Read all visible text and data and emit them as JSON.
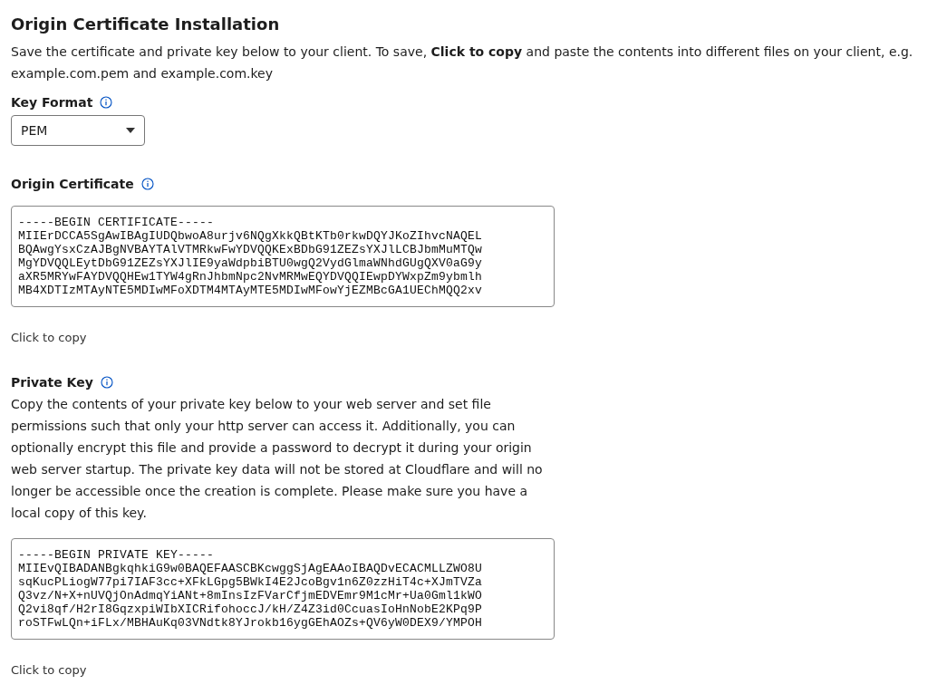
{
  "title": "Origin Certificate Installation",
  "intro": "Save the certificate and private key below to your client. To save, **Click to copy** and paste the contents into different files on your client, e.g. example.com.pem and example.com.key",
  "key_format": {
    "label": "Key Format",
    "value": "PEM"
  },
  "sections": [
    {
      "label": "Origin Certificate",
      "lines": [
        "-----BEGIN CERTIFICATE-----",
        "MIIErDCCA5SgAwIBAgIUDQbwoA8urjv6NQgXkkQBtKTb0rkwDQYJKoZIhvcNAQEL",
        "BQAwgYsxCzAJBgNVBAYTAlVTMRkwFwYDVQQKExBDbG91ZEZsYXJlLCBJbmMuMTQw",
        "MgYDVQQLEytDbG91ZEZsYXJlIE9yaWdpbiBTU0wgQ2VydGlmaWNhdGUgQXV0aG9y",
        "aXR5MRYwFAYDVQQHEw1TYW4gRnJhbmNpc2NvMRMwEQYDVQQIEwpDYWxpZm9ybmlh",
        "MB4XDTIzMTAyNTE5MDIwMFoXDTM4MTAyMTE5MDIwMFowYjEZMBcGA1UEChMQQ2xv"
      ],
      "copy": "Click to copy"
    },
    {
      "label": "Private Key",
      "description": "Copy the contents of your private key below to your web server and set file permissions such that only your http server can access it. Additionally, you can optionally encrypt this file and provide a password to decrypt it during your origin web server startup. The private key data will not be stored at Cloudflare and will no longer be accessible once the creation is complete. Please make sure you have a local copy of this key.",
      "lines": [
        "-----BEGIN PRIVATE KEY-----",
        "MIIEvQIBADANBgkqhkiG9w0BAQEFAASCBKcwggSjAgEAAoIBAQDvECACMLLZWO8U",
        "sqKucPLiogW77pi7IAF3cc+XFkLGpg5BWkI4E2JcoBgv1n6Z0zzHiT4c+XJmTVZa",
        "Q3vz/N+X+nUVQjOnAdmqYiANt+8mInsIzFVarCfjmEDVEmr9M1cMr+Ua0Gml1kWO",
        "Q2vi8qf/H2rI8GqzxpiWIbXICRifohoccJ/kH/Z4Z3id0CcuasIoHnNobE2KPq9P",
        "roSTFwLQn+iFLx/MBHAuKq03VNdtk8YJrokb16ygGEhAOZs+QV6yW0DEX9/YMPOH"
      ],
      "copy": "Click to copy"
    }
  ]
}
